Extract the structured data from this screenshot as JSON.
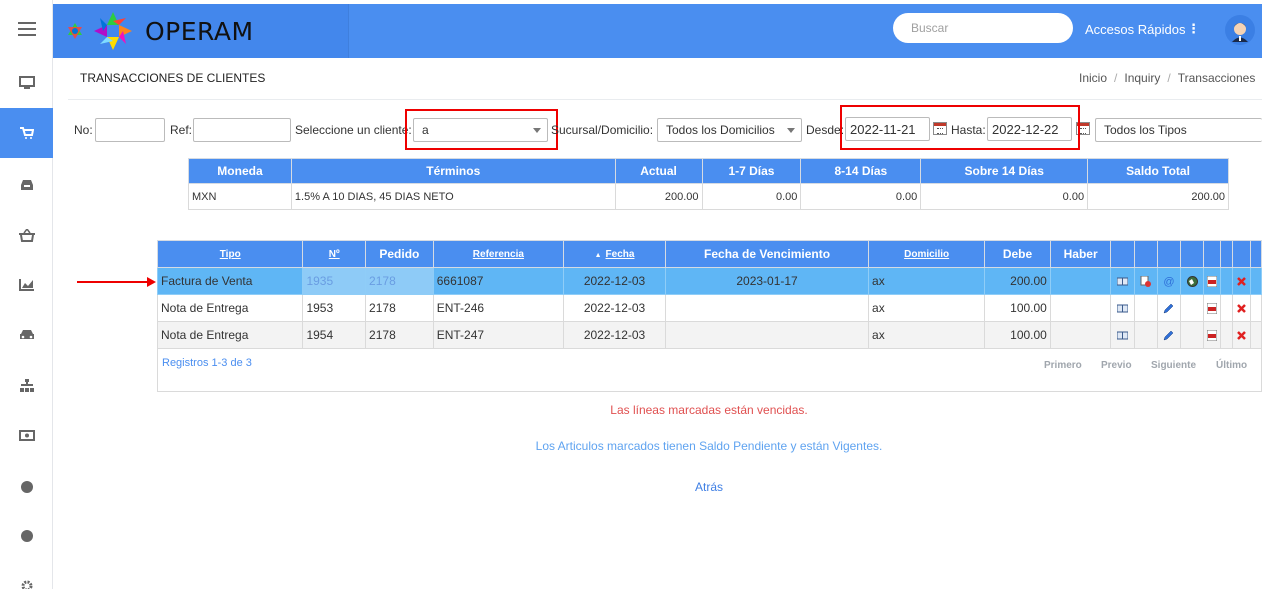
{
  "app": {
    "brand": "OPERAM"
  },
  "topbar": {
    "search_placeholder": "Buscar",
    "quick_access_label": "Accesos Rápidos",
    "quick_access_dots": "⋮",
    "accent_color": "#4a8ef0"
  },
  "sidebar": {
    "items": [
      {
        "icon": "menu-icon"
      },
      {
        "icon": "monitor-icon"
      },
      {
        "icon": "cart-icon",
        "active": true
      },
      {
        "icon": "inbox-icon"
      },
      {
        "icon": "basket-icon"
      },
      {
        "icon": "chart-icon"
      },
      {
        "icon": "car-icon"
      },
      {
        "icon": "sitemap-icon"
      },
      {
        "icon": "money-icon"
      },
      {
        "icon": "circle-icon"
      },
      {
        "icon": "circle-icon"
      },
      {
        "icon": "cog-icon"
      }
    ]
  },
  "page": {
    "title": "TRANSACCIONES DE CLIENTES",
    "breadcrumb": [
      "Inicio",
      "Inquiry",
      "Transacciones"
    ]
  },
  "filters": {
    "no_label": "No:",
    "no_value": "",
    "ref_label": "Ref:",
    "ref_value": "",
    "client_label": "Seleccione un cliente:",
    "client_value": "a",
    "branch_label": "Sucursal/Domicilio:",
    "branch_value": "Todos los Domicilios",
    "from_label": "Desde:",
    "from_value": "2022-11-21",
    "to_label": "Hasta:",
    "to_value": "2022-12-22",
    "type_value": "Todos los Tipos"
  },
  "summary": {
    "headers": [
      "Moneda",
      "Términos",
      "Actual",
      "1-7 Días",
      "8-14 Días",
      "Sobre 14 Días",
      "Saldo Total"
    ],
    "row": [
      "MXN",
      "1.5% A 10 DIAS, 45 DIAS NETO",
      "200.00",
      "0.00",
      "0.00",
      "0.00",
      "200.00"
    ]
  },
  "transactions": {
    "headers": {
      "tipo": "Tipo",
      "no": "Nº",
      "pedido": "Pedido",
      "referencia": "Referencia",
      "fecha": "Fecha",
      "fecha_sort": "▲",
      "vencimiento": "Fecha de Vencimiento",
      "domicilio": "Domicilio",
      "debe": "Debe",
      "haber": "Haber"
    },
    "rows": [
      {
        "tipo": "Factura de Venta",
        "no": "1935",
        "pedido": "2178",
        "referencia": "6661087",
        "fecha": "2022-12-03",
        "vencimiento": "2023-01-17",
        "domicilio": "ax",
        "debe": "200.00",
        "haber": "",
        "selected": true
      },
      {
        "tipo": "Nota de Entrega",
        "no": "1953",
        "pedido": "2178",
        "referencia": "ENT-246",
        "fecha": "2022-12-03",
        "vencimiento": "",
        "domicilio": "ax",
        "debe": "100.00",
        "haber": ""
      },
      {
        "tipo": "Nota de Entrega",
        "no": "1954",
        "pedido": "2178",
        "referencia": "ENT-247",
        "fecha": "2022-12-03",
        "vencimiento": "",
        "domicilio": "ax",
        "debe": "100.00",
        "haber": ""
      }
    ],
    "records_text": "Registros 1-3 de 3",
    "pager": {
      "first": "Primero",
      "prev": "Previo",
      "next": "Siguiente",
      "last": "Último"
    }
  },
  "messages": {
    "overdue": "Las líneas marcadas están vencidas.",
    "pending": "Los Articulos marcados tienen Saldo Pendiente y están Vigentes.",
    "back": "Atrás"
  }
}
